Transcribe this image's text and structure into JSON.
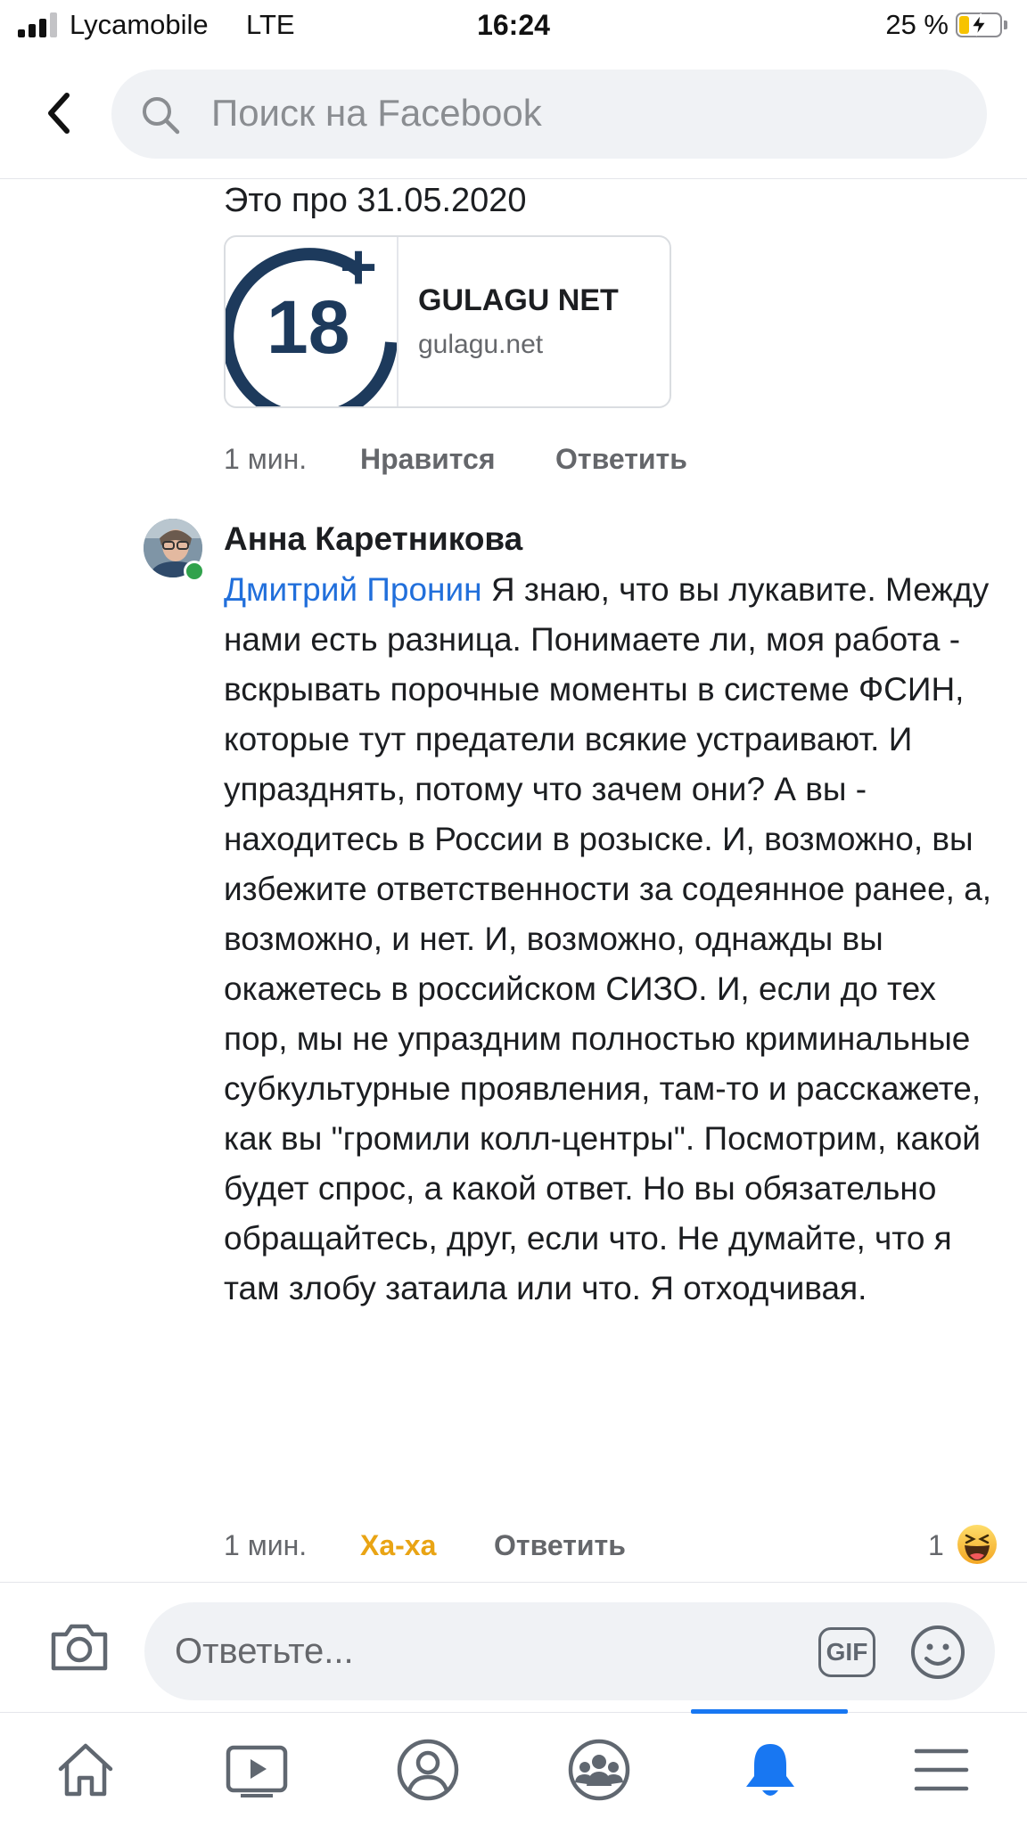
{
  "status_bar": {
    "carrier": "Lycamobile",
    "network": "LTE",
    "time": "16:24",
    "battery_percent": "25 %",
    "battery_level": 0.25,
    "signal_bars_filled": 3,
    "signal_bars_total": 4
  },
  "header": {
    "search_placeholder": "Поиск на Facebook"
  },
  "comment_1": {
    "text_tail": "Это про 31.05.2020",
    "link_card": {
      "logo_text": "18",
      "logo_plus": "+",
      "title": "GULAGU NET",
      "domain": "gulagu.net"
    },
    "time": "1 мин.",
    "like_label": "Нравится",
    "reply_label": "Ответить"
  },
  "comment_2": {
    "author": "Анна Каретникова",
    "mention": "Дмитрий Пронин",
    "text": " Я знаю, что вы лукавите. Между нами есть разница. Понимаете ли, моя работа - вскрывать порочные моменты в системе ФСИН, которые тут предатели всякие устраивают. И упразднять, потому что зачем они? А вы - находитесь в России в розыске. И, возможно, вы избежите ответственности за содеянное ранее, а, возможно, и нет. И, возможно, однажды вы окажетесь в российском СИЗО. И, если до тех пор, мы не упраздним полностью криминальные субкультурные проявления, там-то и расскажете, как вы \"громили колл-центры\". Посмотрим, какой будет спрос, а какой ответ. Но вы обязательно обращайтесь, друг, если что. Не думайте, что я там злобу затаила или что. Я отходчивая.",
    "time": "1 мин.",
    "reaction_label": "Ха-ха",
    "reply_label": "Ответить",
    "reaction_count": "1",
    "reaction_icon": "haha-emoji-icon"
  },
  "reply_bar": {
    "placeholder": "Ответьте...",
    "gif_label": "GIF"
  },
  "tab_bar": {
    "tabs": [
      "home-icon",
      "video-icon",
      "profile-icon",
      "groups-icon",
      "notifications-icon",
      "menu-icon"
    ],
    "active_tab": "notifications-icon"
  },
  "colors": {
    "link_blue": "#216fdb",
    "accent": "#1877f2",
    "haha_yellow": "#e9a414",
    "logo_navy": "#1d3a5c",
    "online_green": "#31a24c"
  }
}
